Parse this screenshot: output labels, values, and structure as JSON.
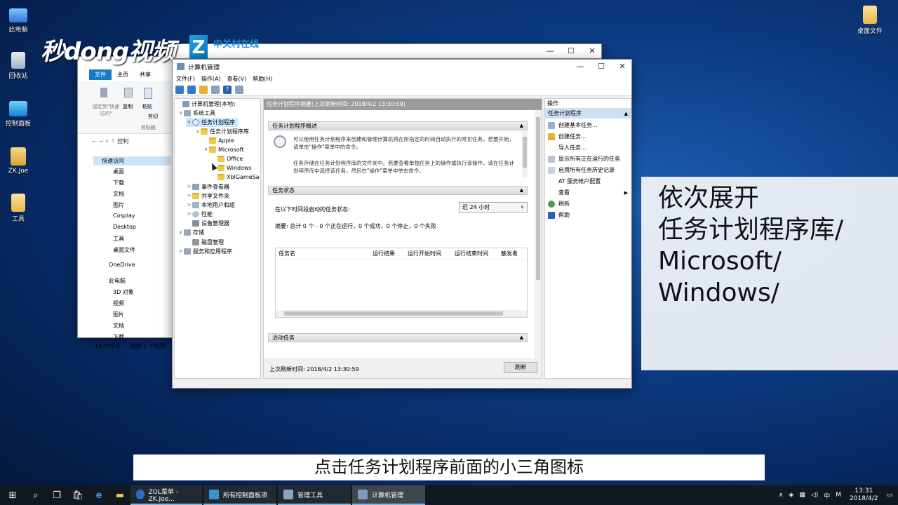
{
  "desktop": {
    "icons_left": [
      "此电脑",
      "回收站",
      "控制面板",
      "ZK.Joe",
      "工具"
    ],
    "icon_right": "桌面文件"
  },
  "watermark": {
    "brand": "秒dong视频",
    "zol_cn": "中关村在线",
    "zol_en": "ZOL.COM.CN"
  },
  "explorer": {
    "ribbon_tabs": [
      "文件",
      "主页",
      "共享"
    ],
    "ribbon_buttons": [
      "固定到\"快速访问\"",
      "复制",
      "粘贴",
      "剪切"
    ],
    "ribbon_group": "剪贴板",
    "address_prefix": "控制",
    "nav_items": [
      "快速访问",
      "桌面",
      "下载",
      "文档",
      "图片",
      "Cosplay",
      "Desktop",
      "工具",
      "桌面文件",
      "OneDrive",
      "此电脑",
      "3D 对象",
      "视频",
      "图片",
      "文档",
      "下载"
    ],
    "status_items": "19 个项目",
    "status_selected": "选中 1 个项目"
  },
  "mmc": {
    "title": "计算机管理",
    "menus": [
      "文件(F)",
      "操作(A)",
      "查看(V)",
      "帮助(H)"
    ],
    "tree": [
      {
        "label": "计算机管理(本地)",
        "level": 0,
        "exp": ""
      },
      {
        "label": "系统工具",
        "level": 1,
        "exp": "∨"
      },
      {
        "label": "任务计划程序",
        "level": 2,
        "exp": "∨"
      },
      {
        "label": "任务计划程序库",
        "level": 3,
        "exp": "∨"
      },
      {
        "label": "Apple",
        "level": 4,
        "exp": ""
      },
      {
        "label": "Microsoft",
        "level": 4,
        "exp": "∨"
      },
      {
        "label": "Office",
        "level": 5,
        "exp": ""
      },
      {
        "label": "Windows",
        "level": 5,
        "exp": ""
      },
      {
        "label": "XblGameSa",
        "level": 5,
        "exp": ""
      },
      {
        "label": "事件查看器",
        "level": 2,
        "exp": ">"
      },
      {
        "label": "共享文件夹",
        "level": 2,
        "exp": ">"
      },
      {
        "label": "本地用户和组",
        "level": 2,
        "exp": ">"
      },
      {
        "label": "性能",
        "level": 2,
        "exp": ">"
      },
      {
        "label": "设备管理器",
        "level": 2,
        "exp": ""
      },
      {
        "label": "存储",
        "level": 1,
        "exp": "∨"
      },
      {
        "label": "磁盘管理",
        "level": 2,
        "exp": ""
      },
      {
        "label": "服务和应用程序",
        "level": 1,
        "exp": ">"
      }
    ],
    "center_header": "任务计划程序摘要(上次刷新时间: 2018/4/2 13:30:59)",
    "overview_title": "任务计划程序概述",
    "overview_p1": "可以使用任务计划程序来创建和管理计算机将在所指定的时间自动执行的常见任务。若要开始，请单击\"操作\"菜单中的命令。",
    "overview_p2": "任务存储在任务计划程序库的文件夹中。若要查看单独任务上的操作或执行该操作，请在任务计划程序库中选择该任务，然后在\"操作\"菜单中单击命令。",
    "status_title": "任务状态",
    "status_label": "在以下时间段启动的任务状态:",
    "status_select": "近 24 小时",
    "status_summary": "摘要: 总计 0 个 - 0 个正在运行，0 个成功，0 个停止，0 个失败",
    "columns": [
      "任务名",
      "运行结果",
      "运行开始时间",
      "运行结束时间",
      "触发者"
    ],
    "active_title": "活动任务",
    "footer_time": "上次刷新时间: 2018/4/2 13:30:59",
    "refresh_button": "刷新",
    "actions_title": "操作",
    "actions_group": "任务计划程序",
    "actions": [
      "创建基本任务...",
      "创建任务...",
      "导入任务...",
      "显示所有正在运行的任务",
      "启用所有任务历史记录",
      "AT 服务帐户配置",
      "查看",
      "刷新",
      "帮助"
    ]
  },
  "overlay_lines": [
    "依次展开",
    "任务计划程序库/",
    "Microsoft/",
    "Windows/"
  ],
  "caption": "点击任务计划程序前面的小三角图标",
  "taskbar": {
    "items": [
      "ZOL菜单 - ZK.Joe...",
      "所有控制面板项",
      "管理工具",
      "计算机管理"
    ],
    "lang": "中",
    "ime": "M",
    "time": "13:31",
    "date": "2018/4/2"
  }
}
